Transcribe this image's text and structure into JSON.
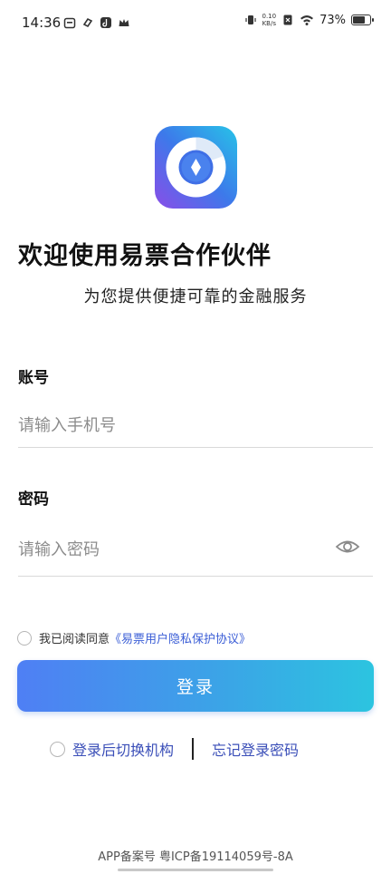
{
  "status_bar": {
    "time": "14:36",
    "net_speed_value": "0.10",
    "net_speed_unit": "KB/s",
    "battery_percent": "73%",
    "battery_level": 0.73
  },
  "header": {
    "title": "欢迎使用易票合作伙伴",
    "subtitle": "为您提供便捷可靠的金融服务"
  },
  "form": {
    "account_label": "账号",
    "account_placeholder": "请输入手机号",
    "account_value": "",
    "password_label": "密码",
    "password_placeholder": "请输入密码",
    "password_value": ""
  },
  "agreement": {
    "text": "我已阅读同意",
    "link": "《易票用户隐私保护协议》",
    "checked": false
  },
  "login_button_label": "登录",
  "bottom": {
    "switch_org_label": "登录后切换机构",
    "forgot_password_label": "忘记登录密码"
  },
  "footer": {
    "icp": "APP备案号 粤ICP备19114059号-8A"
  },
  "colors": {
    "accent": "#3b5ed6",
    "button_gradient_start": "#4f7ff4",
    "button_gradient_end": "#2cc4e0"
  }
}
